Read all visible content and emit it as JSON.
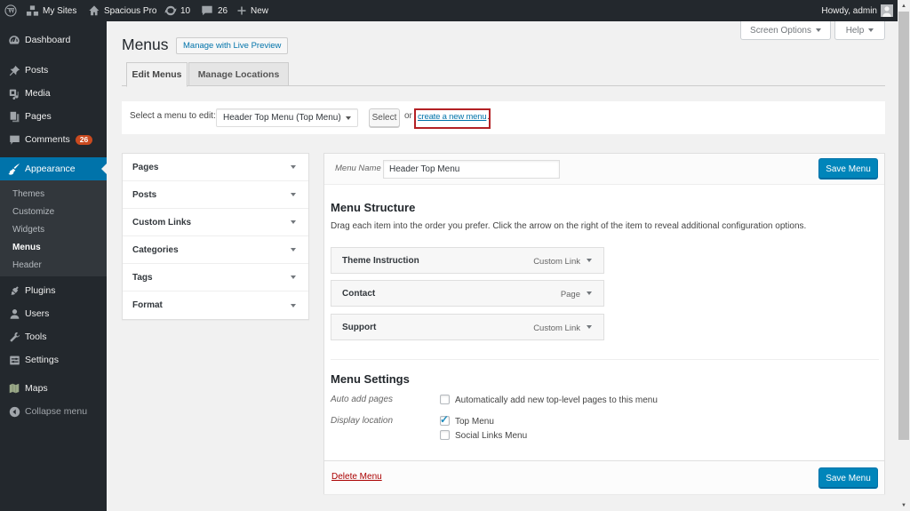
{
  "colors": {
    "admin_dark": "#23282d",
    "submenu_dark": "#32373c",
    "highlight_blue": "#0073aa",
    "primary_button_blue": "#0085ba",
    "badge_orange": "#ca4a1f",
    "annotation_red": "#b32125",
    "delete_red": "#aa0000",
    "page_background": "#f1f1f1"
  },
  "admin_bar": {
    "my_sites": "My Sites",
    "site_name": "Spacious Pro",
    "updates_count": "10",
    "comments_count": "26",
    "new_label": "New",
    "howdy": "Howdy, admin"
  },
  "screen_meta": {
    "screen_options": "Screen Options",
    "help": "Help"
  },
  "sidebar": {
    "items": [
      {
        "label": "Dashboard"
      },
      {
        "label": "Posts"
      },
      {
        "label": "Media"
      },
      {
        "label": "Pages"
      },
      {
        "label": "Comments",
        "badge": "26"
      },
      {
        "label": "Appearance",
        "active": true
      },
      {
        "label": "Plugins"
      },
      {
        "label": "Users"
      },
      {
        "label": "Tools"
      },
      {
        "label": "Settings"
      },
      {
        "label": "Maps"
      },
      {
        "label": "Collapse menu"
      }
    ],
    "appearance_submenu": [
      {
        "label": "Themes"
      },
      {
        "label": "Customize"
      },
      {
        "label": "Widgets"
      },
      {
        "label": "Menus",
        "current": true
      },
      {
        "label": "Header"
      }
    ]
  },
  "page": {
    "title": "Menus",
    "title_action": "Manage with Live Preview",
    "tabs": [
      {
        "label": "Edit Menus",
        "active": true
      },
      {
        "label": "Manage Locations",
        "active": false
      }
    ],
    "select_bar": {
      "label": "Select a menu to edit:",
      "selected_option": "Header Top Menu (Top Menu)",
      "select_button": "Select",
      "or_text": "or",
      "create_link": "create a new menu",
      "after_link": "."
    },
    "add_items_panels": [
      {
        "label": "Pages"
      },
      {
        "label": "Posts"
      },
      {
        "label": "Custom Links"
      },
      {
        "label": "Categories"
      },
      {
        "label": "Tags"
      },
      {
        "label": "Format"
      }
    ],
    "editor": {
      "menu_name_label": "Menu Name",
      "menu_name_value": "Header Top Menu",
      "save_button": "Save Menu",
      "structure_heading": "Menu Structure",
      "structure_help": "Drag each item into the order you prefer. Click the arrow on the right of the item to reveal additional configuration options.",
      "items": [
        {
          "label": "Theme Instruction",
          "type": "Custom Link"
        },
        {
          "label": "Contact",
          "type": "Page"
        },
        {
          "label": "Support",
          "type": "Custom Link"
        }
      ],
      "settings_heading": "Menu Settings",
      "auto_add_label": "Auto add pages",
      "auto_add_option": "Automatically add new top-level pages to this menu",
      "display_location_label": "Display location",
      "locations": [
        {
          "label": "Top Menu",
          "checked": true
        },
        {
          "label": "Social Links Menu",
          "checked": false
        }
      ],
      "delete_link": "Delete Menu",
      "footer_save_button": "Save Menu"
    }
  }
}
